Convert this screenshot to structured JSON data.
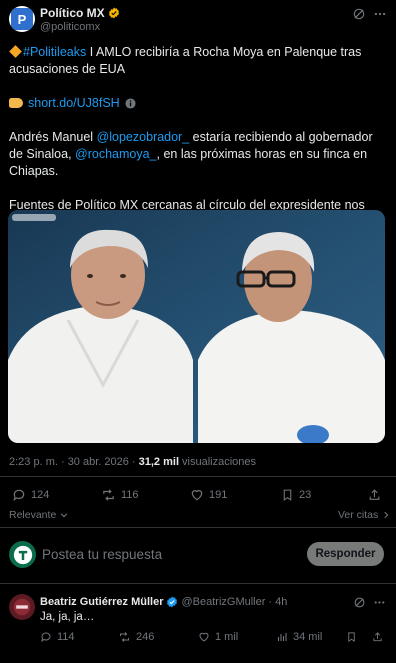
{
  "author": {
    "name": "Político MX",
    "handle": "@politicomx"
  },
  "tweet": {
    "line1_tag": "#Politileaks",
    "line1_rest": " I AMLO recibiría a Rocha Moya en Palenque tras acusaciones de EUA",
    "link_text": "short.do/UJ8fSH",
    "p2_a": "Andrés Manuel ",
    "p2_mention1": "@lopezobrador_",
    "p2_b": " estaría recibiendo al gobernador de Sinaloa, ",
    "p2_mention2": "@rochamoya_",
    "p2_c": ", en las próximas horas en su finca en Chiapas.",
    "p3": "Fuentes de Político MX cercanas al círculo del expresidente nos indican que en Palenque se estaría preparando todo para esta reunión."
  },
  "meta": {
    "time": "2:23 p. m. · 30 abr. 2026 · ",
    "views": "31,2 mil",
    "views_label": " visualizaciones"
  },
  "actions": {
    "replies": "124",
    "reposts": "116",
    "likes": "191",
    "bookmarks": "23"
  },
  "sort": {
    "relevante": "Relevante",
    "ver_citas": "Ver citas"
  },
  "composer": {
    "placeholder": "Postea tu respuesta",
    "button": "Responder"
  },
  "reply": {
    "name": "Beatriz Gutiérrez Müller",
    "handle": "@BeatrizGMuller",
    "time": "· 4h",
    "text": "Ja, ja, ja…",
    "replies": "114",
    "reposts": "246",
    "likes": "1 mil",
    "views": "34 mil"
  },
  "colors": {
    "accent": "#1d9bf0",
    "muted": "#71767b",
    "background": "#000000",
    "verified": "#f4b400"
  }
}
